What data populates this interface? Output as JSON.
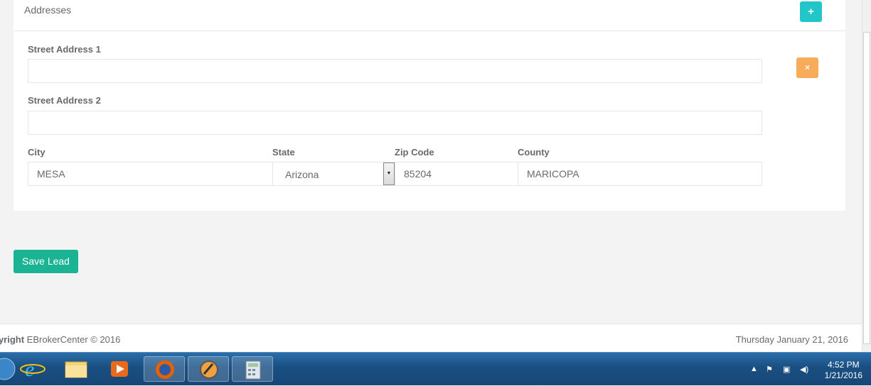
{
  "panel": {
    "title": "Addresses",
    "add_button": "+",
    "remove_button": "×"
  },
  "address": {
    "street1_label": "Street Address 1",
    "street1_value": "",
    "street2_label": "Street Address 2",
    "street2_value": "",
    "city_label": "City",
    "city_value": "MESA",
    "state_label": "State",
    "state_value": "Arizona",
    "zip_label": "Zip Code",
    "zip_value": "85204",
    "county_label": "County",
    "county_value": "MARICOPA"
  },
  "actions": {
    "save_label": "Save Lead"
  },
  "footer": {
    "copyright_bold": "pyright",
    "copyright_text": " EBrokerCenter © 2016",
    "date": "Thursday January 21, 2016"
  },
  "taskbar": {
    "time": "4:52 PM",
    "date": "1/21/2016",
    "apps": [
      "internet-explorer-icon",
      "file-explorer-icon",
      "media-player-icon",
      "firefox-icon",
      "remote-support-icon",
      "calculator-icon"
    ]
  },
  "colors": {
    "add": "#23c6c8",
    "remove": "#f8ac59",
    "save": "#1ab394"
  }
}
